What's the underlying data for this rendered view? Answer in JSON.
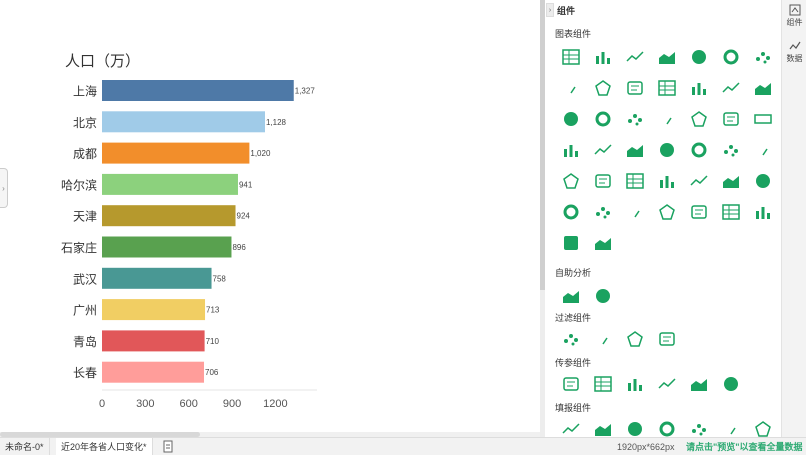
{
  "canvas": {
    "chart_title": "人口（万）"
  },
  "chart_data": {
    "type": "bar",
    "orientation": "horizontal",
    "title": "人口（万）",
    "categories": [
      "上海",
      "北京",
      "成都",
      "哈尔滨",
      "天津",
      "石家庄",
      "武汉",
      "广州",
      "青岛",
      "长春"
    ],
    "values": [
      1327,
      1128,
      1020,
      941,
      924,
      896,
      758,
      713,
      710,
      706
    ],
    "value_labels": [
      "1,327",
      "1,128",
      "1,020",
      "941",
      "924",
      "896",
      "758",
      "713",
      "710",
      "706"
    ],
    "colors": [
      "#4e79a7",
      "#a0cbe8",
      "#f28e2b",
      "#8cd17d",
      "#b6992d",
      "#59a14f",
      "#499894",
      "#f1ce63",
      "#e15759",
      "#ff9d9a"
    ],
    "xticks": [
      "0",
      "300",
      "600",
      "900",
      "1200"
    ],
    "xtick_values": [
      0,
      300,
      600,
      900,
      1200
    ],
    "xlim": [
      0,
      1400
    ],
    "grid": false,
    "legend": "none"
  },
  "panel": {
    "title": "组件",
    "sections": [
      {
        "title": "图表组件",
        "icons": [
          "table-icon",
          "cross-table-icon",
          "grouped-table-icon",
          "column-chart-icon",
          "stacked-column-icon",
          "percent-column-icon",
          "range-column-icon",
          "line-chart-icon",
          "multi-line-icon",
          "area-chart-icon",
          "stream-area-icon",
          "pie-chart-icon",
          "ellipse-pie-icon",
          "donut-chart-icon",
          "rose-chart-icon",
          "ring-progress-icon",
          "scatter-chart-icon",
          "bubble-chart-icon",
          "multi-bubble-icon",
          "word-cloud-icon",
          "number-kpi-icon",
          "gauge-icon",
          "funnel-icon",
          "world-map-icon",
          "point-map-icon",
          "radar-chart-icon",
          "polygon-radar-icon",
          "step-column-icon",
          "combo-chart-icon",
          "histogram-icon",
          "box-plot-icon",
          "heatmap-table-icon",
          "network-graph-icon",
          "sankey-icon",
          "leaf-map-icon",
          "tree-chart-icon",
          "gantt-icon",
          "text-list-icon",
          "globe-icon",
          "region-map-icon",
          "candlestick-icon",
          "flow-map-icon",
          "js-custom-icon",
          "sparkline-icon"
        ]
      },
      {
        "title": "自助分析",
        "icons": [
          "insight-bulb-icon",
          "comment-icon"
        ]
      },
      {
        "title": "过滤组件",
        "icons": [
          "list-filter-icon",
          "tree-filter-icon",
          "slider-filter-icon",
          "date-filter-icon"
        ]
      },
      {
        "title": "传参组件",
        "icons": [
          "list-param-icon",
          "tree-param-icon",
          "dropdown-param-icon",
          "text-param-icon",
          "slider-param-icon",
          "search-param-icon"
        ]
      },
      {
        "title": "填报组件",
        "icons": [
          "form-edit-icon",
          "form-card-icon",
          "form-list-icon",
          "form-tree-icon",
          "form-dropdown-icon",
          "form-text-icon",
          "form-search-icon"
        ]
      }
    ],
    "accent": "#1aa260"
  },
  "tabbar": {
    "components_label": "组件",
    "data_label": "数据"
  },
  "status": {
    "tab1": "未命名-0*",
    "tab2": "近20年各省人口变化*",
    "canvas_size": "1920px*662px",
    "preview_hint": "请点击\"预览\"以查看全量数据"
  }
}
